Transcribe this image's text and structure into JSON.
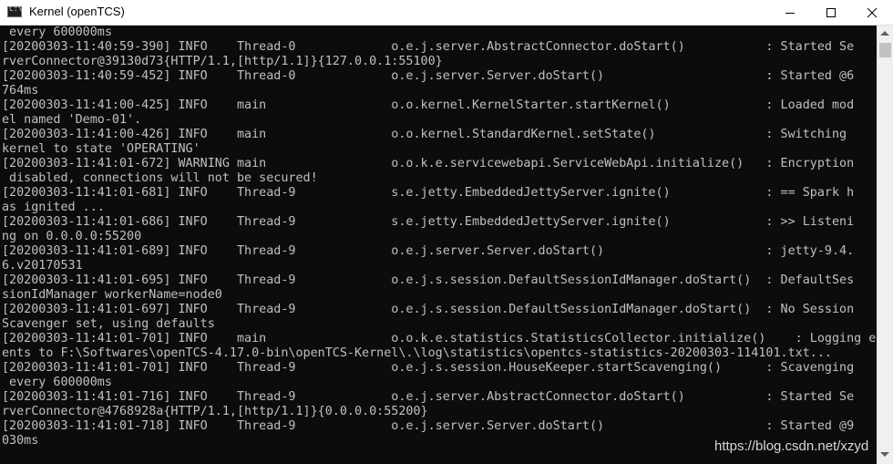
{
  "window": {
    "title": "Kernel (openTCS)",
    "icon_label": "C:\\",
    "icon_name": "console-icon",
    "buttons": {
      "minimize_icon": "minimize-icon",
      "maximize_icon": "maximize-icon",
      "close_icon": "close-icon"
    }
  },
  "console": {
    "background": "#0c0c0c",
    "text_color": "#c0c0c0",
    "lines": [
      " every 600000ms",
      "[20200303-11:40:59-390] INFO    Thread-0             o.e.j.server.AbstractConnector.doStart()           : Started Se",
      "rverConnector@39130d73{HTTP/1.1,[http/1.1]}{127.0.0.1:55100}",
      "[20200303-11:40:59-452] INFO    Thread-0             o.e.j.server.Server.doStart()                      : Started @6",
      "764ms",
      "[20200303-11:41:00-425] INFO    main                 o.o.kernel.KernelStarter.startKernel()             : Loaded mod",
      "el named 'Demo-01'.",
      "[20200303-11:41:00-426] INFO    main                 o.o.kernel.StandardKernel.setState()               : Switching",
      "kernel to state 'OPERATING'",
      "[20200303-11:41:01-672] WARNING main                 o.o.k.e.servicewebapi.ServiceWebApi.initialize()   : Encryption",
      " disabled, connections will not be secured!",
      "[20200303-11:41:01-681] INFO    Thread-9             s.e.jetty.EmbeddedJettyServer.ignite()             : == Spark h",
      "as ignited ...",
      "[20200303-11:41:01-686] INFO    Thread-9             s.e.jetty.EmbeddedJettyServer.ignite()             : >> Listeni",
      "ng on 0.0.0.0:55200",
      "[20200303-11:41:01-689] INFO    Thread-9             o.e.j.server.Server.doStart()                      : jetty-9.4.",
      "6.v20170531",
      "[20200303-11:41:01-695] INFO    Thread-9             o.e.j.s.session.DefaultSessionIdManager.doStart()  : DefaultSes",
      "sionIdManager workerName=node0",
      "[20200303-11:41:01-697] INFO    Thread-9             o.e.j.s.session.DefaultSessionIdManager.doStart()  : No Session",
      "Scavenger set, using defaults",
      "[20200303-11:41:01-701] INFO    main                 o.o.k.e.statistics.StatisticsCollector.initialize()    : Logging ev",
      "ents to F:\\Softwares\\openTCS-4.17.0-bin\\openTCS-Kernel\\.\\log\\statistics\\opentcs-statistics-20200303-114101.txt...",
      "[20200303-11:41:01-701] INFO    Thread-9             o.e.j.s.session.HouseKeeper.startScavenging()      : Scavenging",
      " every 600000ms",
      "[20200303-11:41:01-716] INFO    Thread-9             o.e.j.server.AbstractConnector.doStart()           : Started Se",
      "rverConnector@4768928a{HTTP/1.1,[http/1.1]}{0.0.0.0:55200}",
      "[20200303-11:41:01-718] INFO    Thread-9             o.e.j.server.Server.doStart()                      : Started @9",
      "030ms"
    ]
  },
  "scrollbar": {
    "up_icon": "scroll-up-arrow-icon",
    "down_icon": "scroll-down-arrow-icon"
  },
  "watermark": "https://blog.csdn.net/xzyd"
}
